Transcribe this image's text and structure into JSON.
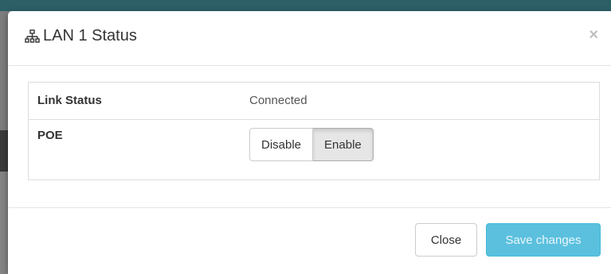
{
  "modal": {
    "title": "LAN 1 Status",
    "close_symbol": "×",
    "title_icon": "network-icon"
  },
  "status": {
    "rows": [
      {
        "label": "Link Status",
        "value": "Connected"
      },
      {
        "label": "POE"
      }
    ],
    "poe": {
      "options": [
        "Disable",
        "Enable"
      ],
      "selected": "Enable"
    }
  },
  "footer": {
    "close_label": "Close",
    "save_label": "Save changes"
  },
  "colors": {
    "primary_info": "#5bc0de",
    "header_bar": "#2d5f66"
  }
}
